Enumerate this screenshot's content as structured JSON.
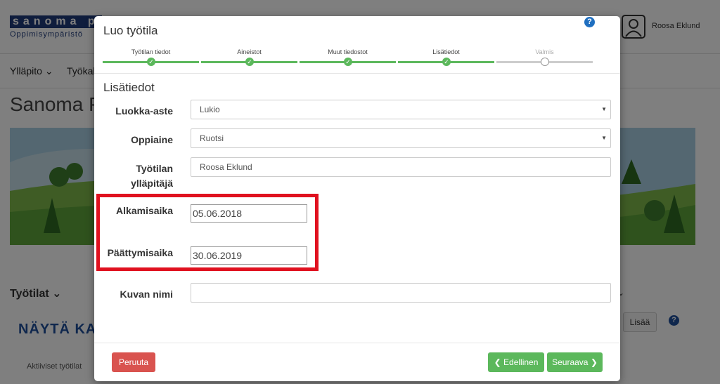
{
  "background": {
    "brand": {
      "logo_text": "sanoma",
      "logo_cut": "p",
      "subtitle": "Oppimisympäristö"
    },
    "user": {
      "name": "Roosa Eklund"
    },
    "nav": {
      "item1": "Ylläpito",
      "item2": "Työkal"
    },
    "page_title": "Sanoma P",
    "section_title": "Työtilat",
    "show_heading": "NÄYTÄ KA",
    "active_text": "Aktiiviset työtilat",
    "add_button": "Lisää",
    "help_glyph": "?"
  },
  "modal": {
    "title": "Luo työtila",
    "help_glyph": "?",
    "steps": [
      {
        "label": "Työtilan tiedot",
        "state": "done"
      },
      {
        "label": "Aineistot",
        "state": "done"
      },
      {
        "label": "Muut tiedostot",
        "state": "done"
      },
      {
        "label": "Lisätiedot",
        "state": "done"
      },
      {
        "label": "Valmis",
        "state": "pending"
      }
    ],
    "section_heading": "Lisätiedot",
    "fields": {
      "grade": {
        "label": "Luokka-aste",
        "value": "Lukio"
      },
      "subject": {
        "label": "Oppiaine",
        "value": "Ruotsi"
      },
      "admin": {
        "label_line1": "Työtilan",
        "label_line2": "ylläpitäjä",
        "value": "Roosa Eklund"
      },
      "start": {
        "label": "Alkamisaika",
        "value": "05.06.2018"
      },
      "end": {
        "label": "Päättymisaika",
        "value": "30.06.2019"
      },
      "image_name": {
        "label": "Kuvan nimi",
        "value": ""
      }
    },
    "buttons": {
      "cancel": "Peruuta",
      "previous": "Edellinen",
      "next": "Seuraava"
    },
    "highlight_color": "#e0111f",
    "accent_color": "#5cb85c",
    "danger_color": "#d9534f"
  }
}
